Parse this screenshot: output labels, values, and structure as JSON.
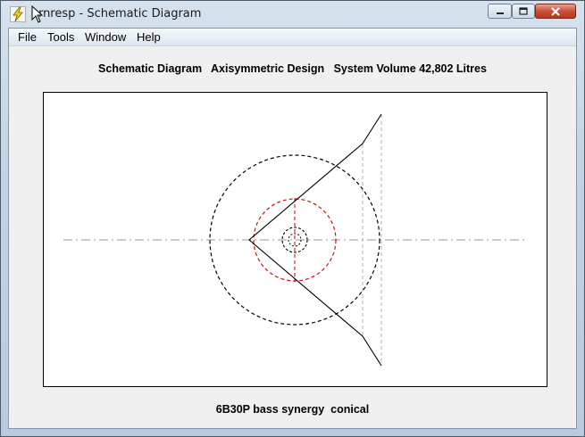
{
  "window": {
    "title": "Hornresp - Schematic Diagram",
    "title_visible": "ornresp - Schematic Diagram",
    "app_icon": "lightning-icon"
  },
  "menu": {
    "items": [
      {
        "label": "File"
      },
      {
        "label": "Tools"
      },
      {
        "label": "Window"
      },
      {
        "label": "Help"
      }
    ]
  },
  "diagram": {
    "header": "Schematic Diagram   Axisymmetric Design   System Volume 42,802 Litres",
    "footer": "6B30P bass synergy  conical"
  },
  "colors": {
    "outline": "#000000",
    "accent": "#d01010",
    "centerline": "#9a9a9a",
    "close_button": "#c9503a"
  }
}
